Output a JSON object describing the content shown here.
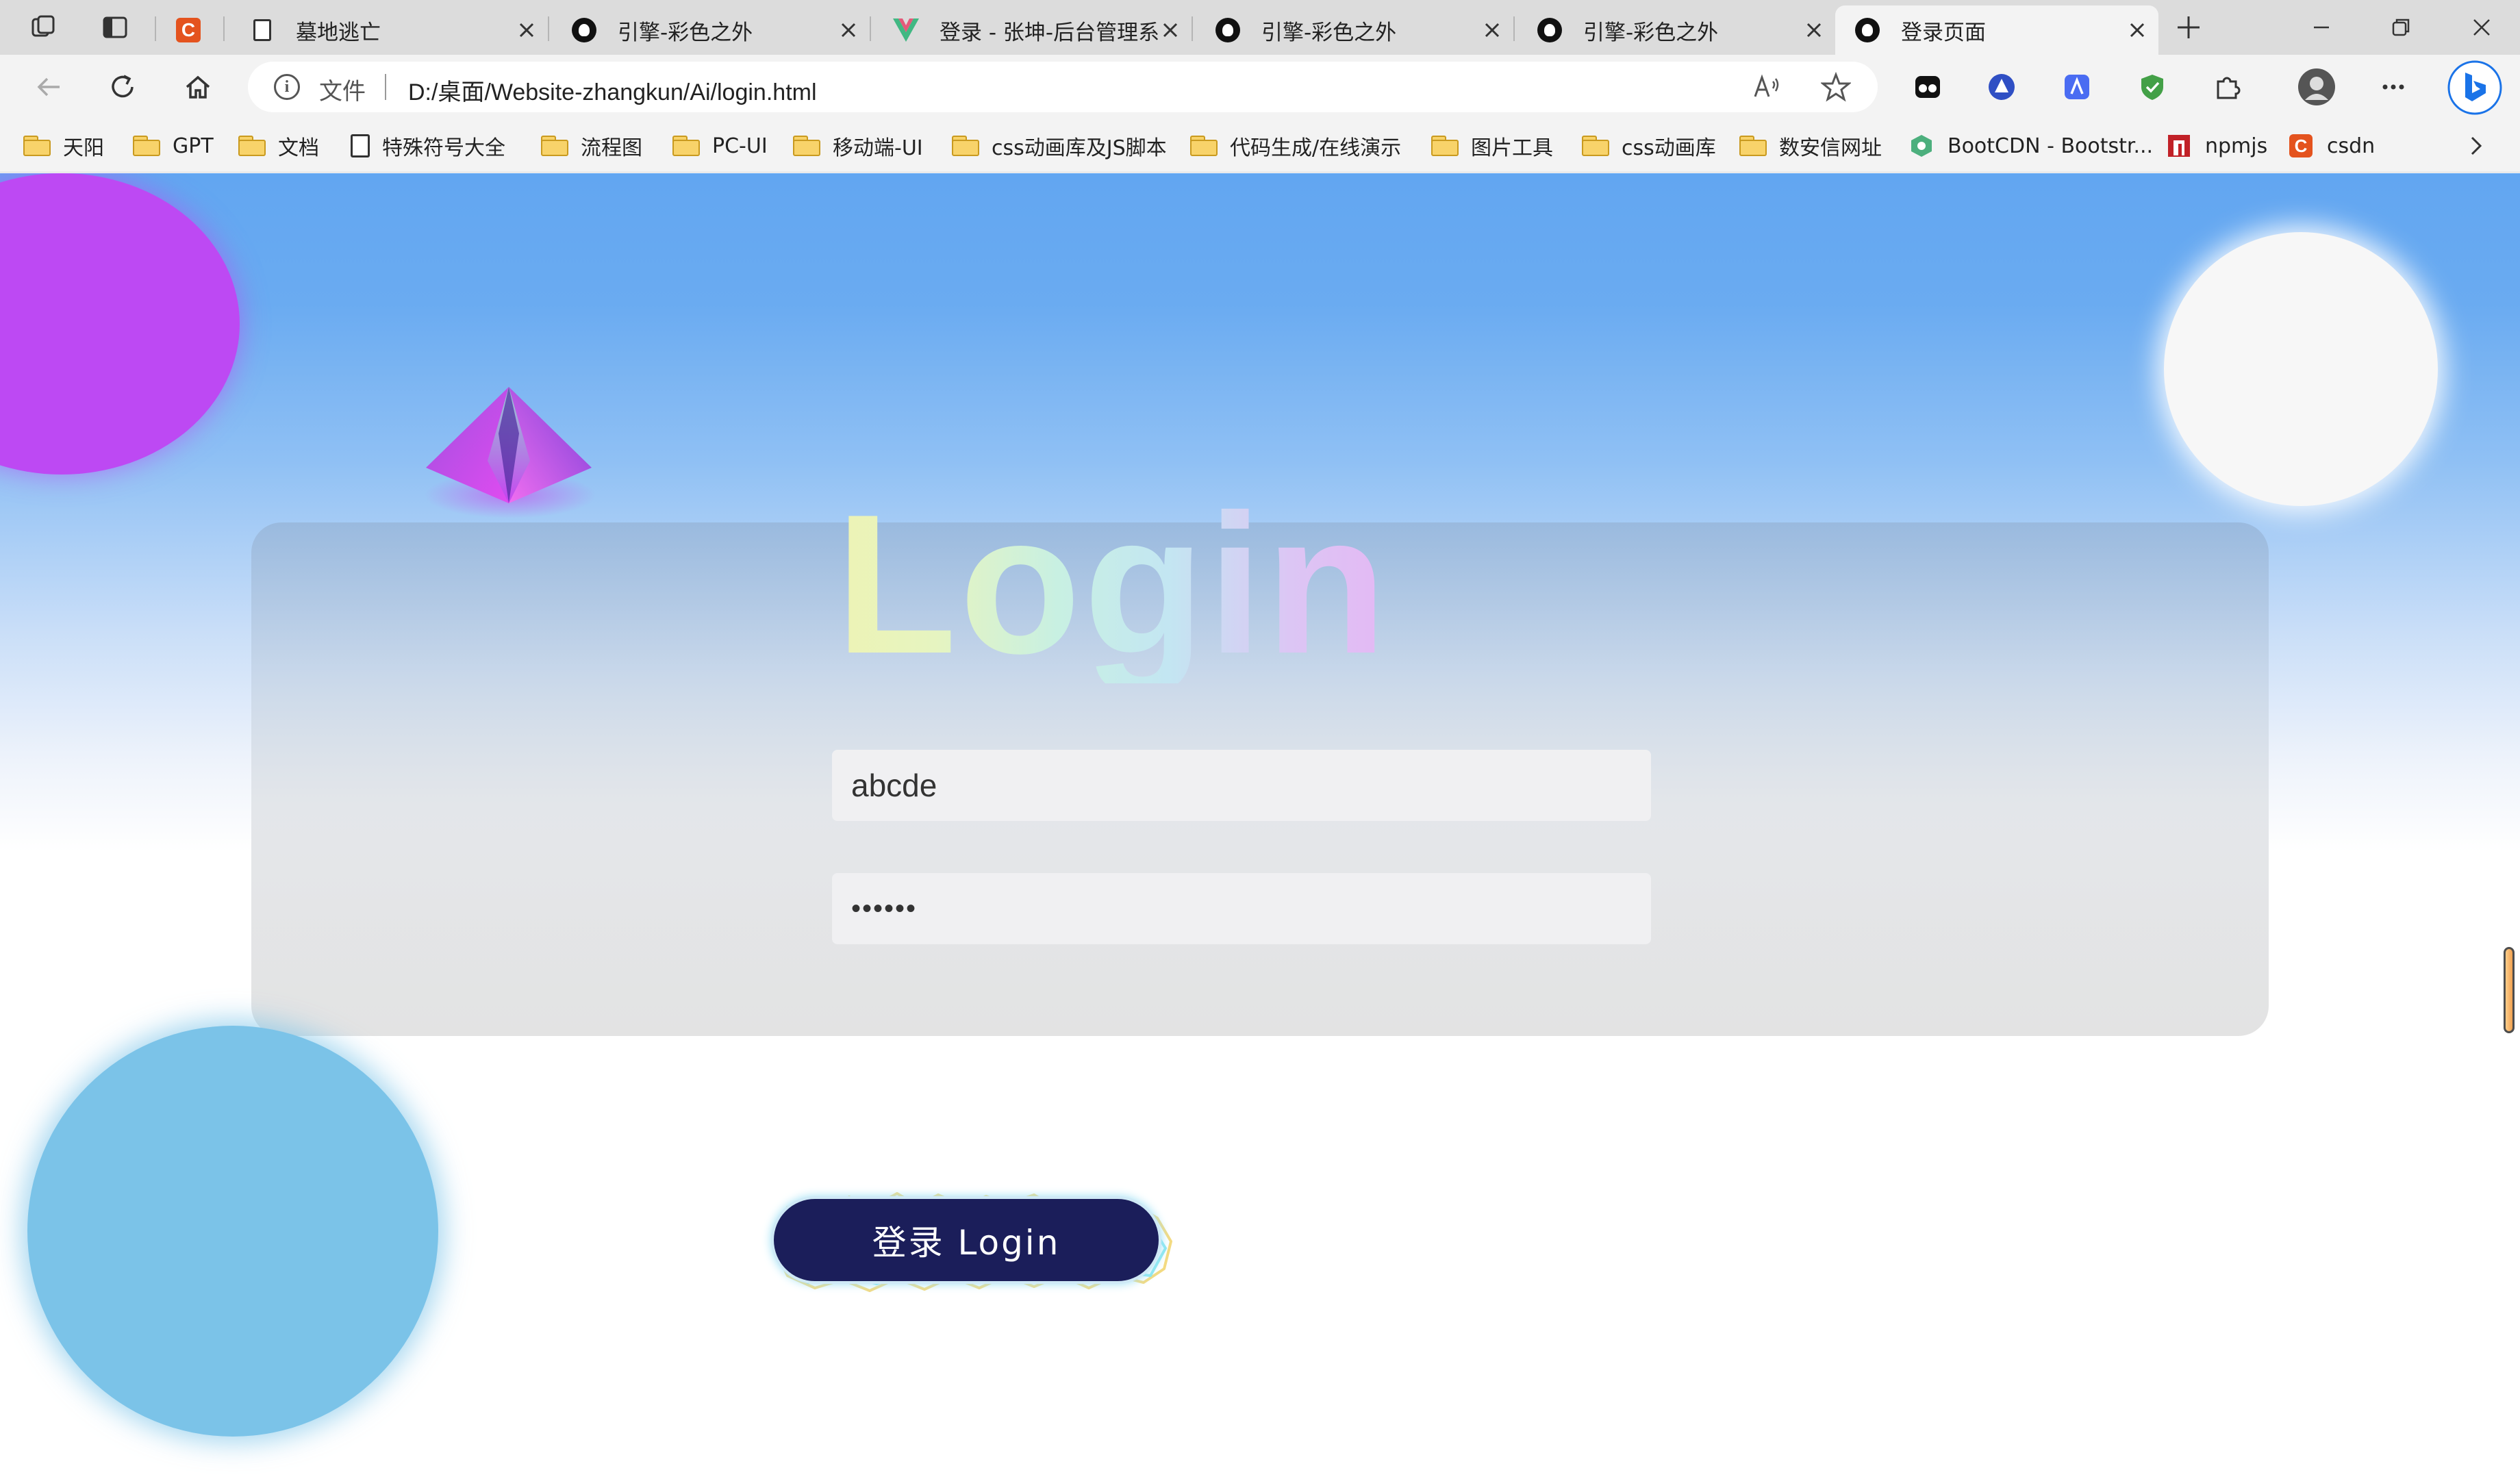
{
  "browser": {
    "tabs": [
      {
        "title": "",
        "favicon": "csdn-favicon",
        "active": false
      },
      {
        "title": "墓地逃亡",
        "favicon": "page-icon",
        "active": false
      },
      {
        "title": "引擎-彩色之外",
        "favicon": "github-icon",
        "active": false
      },
      {
        "title": "登录 - 张坤-后台管理系",
        "favicon": "vue-icon",
        "active": false
      },
      {
        "title": "引擎-彩色之外",
        "favicon": "github-icon",
        "active": false
      },
      {
        "title": "引擎-彩色之外",
        "favicon": "github-icon",
        "active": false
      },
      {
        "title": "登录页面",
        "favicon": "github-icon",
        "active": true
      }
    ],
    "address": {
      "scheme_label": "文件",
      "url": "D:/桌面/Website-zhangkun/Ai/login.html"
    },
    "bookmarks": [
      {
        "label": "天阳",
        "icon": "folder-icon"
      },
      {
        "label": "GPT",
        "icon": "folder-icon"
      },
      {
        "label": "文档",
        "icon": "folder-icon"
      },
      {
        "label": "特殊符号大全",
        "icon": "page-icon"
      },
      {
        "label": "流程图",
        "icon": "folder-icon"
      },
      {
        "label": "PC-UI",
        "icon": "folder-icon"
      },
      {
        "label": "移动端-UI",
        "icon": "folder-icon"
      },
      {
        "label": "css动画库及JS脚本",
        "icon": "folder-icon"
      },
      {
        "label": "代码生成/在线演示",
        "icon": "folder-icon"
      },
      {
        "label": "图片工具",
        "icon": "folder-icon"
      },
      {
        "label": "css动画库",
        "icon": "folder-icon"
      },
      {
        "label": "数安信网址",
        "icon": "folder-icon"
      },
      {
        "label": "BootCDN - Bootstr...",
        "icon": "bootcdn-icon"
      },
      {
        "label": "npmjs",
        "icon": "npm-icon"
      },
      {
        "label": "csdn",
        "icon": "csdn-icon"
      }
    ]
  },
  "page": {
    "title": "Login",
    "username_value": "abcde",
    "password_value": "••••••",
    "login_button_label": "登录 Login"
  },
  "colors": {
    "accent_purple": "#bd49f3",
    "button_navy": "#1b1e5a",
    "sky_blue": "#62a6f1",
    "bubble_blue": "#7bc3e8"
  }
}
